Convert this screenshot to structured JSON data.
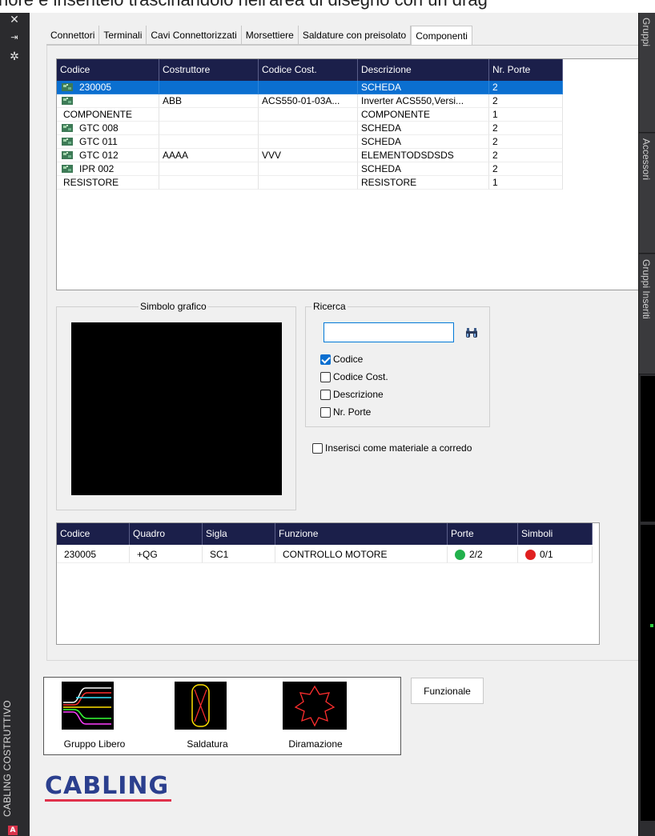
{
  "top_caption": "nore e inseritelo trascinandolo nell'area di disegno con un drag",
  "left_strip": {
    "icons": [
      "close-icon",
      "pin-icon",
      "settings-icon"
    ],
    "vertical_title": "CABLING COSTRUTTIVO",
    "badge": "A"
  },
  "right_strip": {
    "tabs": [
      "Gruppi",
      "Accessori",
      "Gruppi Inseriti"
    ]
  },
  "tabs": [
    {
      "label": "Connettori"
    },
    {
      "label": "Terminali"
    },
    {
      "label": "Cavi Connettorizzati"
    },
    {
      "label": "Morsettiere"
    },
    {
      "label": "Saldature con preisolato"
    },
    {
      "label": "Componenti",
      "active": true
    }
  ],
  "components_table": {
    "columns": [
      "Codice",
      "Costruttore",
      "Codice Cost.",
      "Descrizione",
      "Nr. Porte"
    ],
    "rows": [
      {
        "codice": "230005",
        "costruttore": "",
        "codice_cost": "",
        "descrizione": "SCHEDA",
        "porte": "2",
        "icon": true,
        "selected": true
      },
      {
        "codice": "",
        "costruttore": "ABB",
        "codice_cost": "ACS550-01-03A...",
        "descrizione": "Inverter ACS550,Versi...",
        "porte": "2",
        "icon": true
      },
      {
        "codice": "COMPONENTE",
        "costruttore": "",
        "codice_cost": "",
        "descrizione": "COMPONENTE",
        "porte": "1",
        "icon": false
      },
      {
        "codice": "GTC 008",
        "costruttore": "",
        "codice_cost": "",
        "descrizione": "SCHEDA",
        "porte": "2",
        "icon": true
      },
      {
        "codice": "GTC 011",
        "costruttore": "",
        "codice_cost": "",
        "descrizione": "SCHEDA",
        "porte": "2",
        "icon": true
      },
      {
        "codice": "GTC 012",
        "costruttore": "AAAA",
        "codice_cost": "VVV",
        "descrizione": "ELEMENTODSDSDS",
        "porte": "2",
        "icon": true
      },
      {
        "codice": "IPR 002",
        "costruttore": "",
        "codice_cost": "",
        "descrizione": "SCHEDA",
        "porte": "2",
        "icon": true
      },
      {
        "codice": "RESISTORE",
        "costruttore": "",
        "codice_cost": "",
        "descrizione": "RESISTORE",
        "porte": "1",
        "icon": false
      }
    ]
  },
  "symbol_group": {
    "title": "Simbolo grafico"
  },
  "search_group": {
    "title": "Ricerca",
    "input_value": "",
    "search_icon": "binoculars-icon",
    "options": [
      {
        "label": "Codice",
        "checked": true
      },
      {
        "label": "Codice Cost.",
        "checked": false
      },
      {
        "label": "Descrizione",
        "checked": false
      },
      {
        "label": "Nr. Porte",
        "checked": false
      }
    ]
  },
  "insert_as_material": {
    "label": "Inserisci come materiale a corredo",
    "checked": false
  },
  "placed_table": {
    "columns": [
      "Codice",
      "Quadro",
      "Sigla",
      "Funzione",
      "Porte",
      "Simboli"
    ],
    "rows": [
      {
        "codice": "230005",
        "quadro": "+QG",
        "sigla": "SC1",
        "funzione": "CONTROLLO MOTORE",
        "porte": "2/2",
        "porte_status": "#22b14c",
        "simboli": "0/1",
        "simboli_status": "#e02020"
      }
    ]
  },
  "bottom_tools": [
    {
      "label": "Gruppo Libero",
      "icon": "gruppo-libero-icon"
    },
    {
      "label": "Saldatura",
      "icon": "saldatura-icon"
    },
    {
      "label": "Diramazione",
      "icon": "diramazione-icon"
    }
  ],
  "funzionale_button": "Funzionale",
  "logo": {
    "text": "CABLING",
    "colors": {
      "primary": "#2b3f8e",
      "accent": "#e0314b"
    }
  },
  "colors": {
    "header_bg": "#1b1f4a",
    "selection": "#0b6fd0"
  }
}
